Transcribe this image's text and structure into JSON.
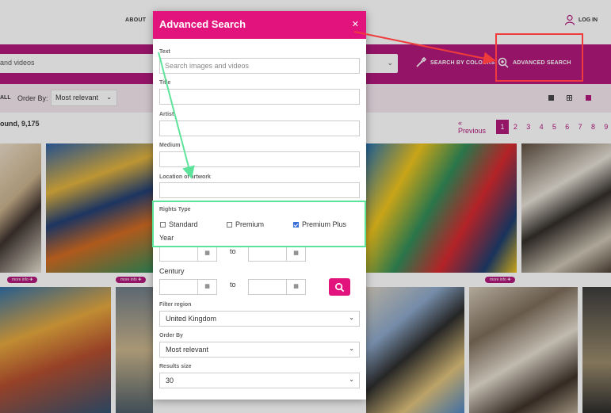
{
  "nav": {
    "about": "ABOUT",
    "login": "LOG IN"
  },
  "search_bar": {
    "placeholder": "and videos",
    "search_by_colours": "SEARCH BY COLOURS",
    "advanced_search": "ADVANCED SEARCH"
  },
  "filter_bar": {
    "all_label": "ALL",
    "order_by_label": "Order By:",
    "order_by_value": "Most relevant"
  },
  "results": {
    "count_text": "ound, 9,175"
  },
  "pagination": {
    "prev": "« Previous",
    "pages": [
      "1",
      "2",
      "3",
      "4",
      "5",
      "6",
      "7",
      "8",
      "9"
    ],
    "active": "1"
  },
  "badges": [
    "more info ✚",
    "more info ✚",
    "more info ✚"
  ],
  "modal": {
    "title": "Advanced Search",
    "close": "✕",
    "text_label": "Text",
    "text_placeholder": "Search images and videos",
    "title_label": "Title",
    "artist_label": "Artist",
    "medium_label": "Medium",
    "location_label": "Location of artwork",
    "rights_label": "Rights Type",
    "rights_options": [
      {
        "label": "Standard",
        "checked": false
      },
      {
        "label": "Premium",
        "checked": false
      },
      {
        "label": "Premium Plus",
        "checked": true
      }
    ],
    "year_label": "Year",
    "century_label": "Century",
    "to_label": "to",
    "calendar_glyph": "▦",
    "region_label": "Filter region",
    "region_value": "United Kingdom",
    "order_label": "Order By",
    "order_value": "Most relevant",
    "size_label": "Results size",
    "size_value": "30"
  },
  "colors": {
    "brand": "#e3137e",
    "band": "#b0157b",
    "annotation_red": "#ef3b3b",
    "annotation_green": "#5ee39a"
  }
}
